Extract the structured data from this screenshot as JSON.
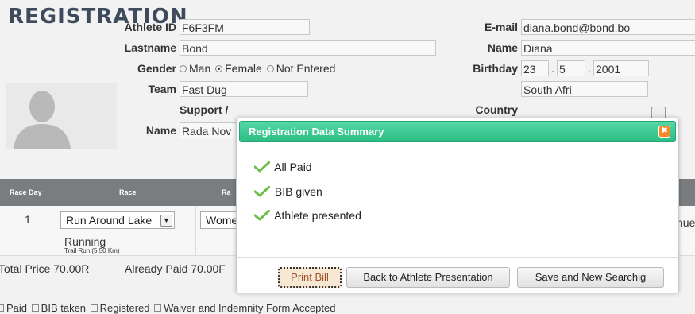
{
  "page": {
    "title": "REGISTRATION"
  },
  "form": {
    "athlete_id": {
      "label": "Athlete ID",
      "value": "F6F3FM"
    },
    "lastname": {
      "label": "Lastname",
      "value": "Bond"
    },
    "gender": {
      "label": "Gender",
      "options": [
        "Man",
        "Female",
        "Not Entered"
      ],
      "selected": "Female"
    },
    "team": {
      "label": "Team",
      "value": "Fast Dug"
    },
    "support": {
      "label": "Support /"
    },
    "name2": {
      "label": "Name",
      "value": "Rada Nov"
    },
    "email": {
      "label": "E-mail",
      "value": "diana.bond@bond.bo"
    },
    "name": {
      "label": "Name",
      "value": "Diana"
    },
    "birthday": {
      "label": "Birthday",
      "day": "23",
      "month": "5",
      "year": "2001",
      "sep": "."
    },
    "country": {
      "label": "Country",
      "value": "South Afri"
    }
  },
  "table": {
    "headers": {
      "race_day": "Race Day",
      "race": "Race",
      "race2": "Ra"
    },
    "row": {
      "day": "1",
      "race_select": "Run Around Lake",
      "race_type": "Running",
      "race_sub": "Trail Run (5.50 Km)",
      "category": "Wome",
      "right_cut": "nue"
    }
  },
  "footer": {
    "total": "Total Price 70.00R",
    "already": "Already Paid 70.00F",
    "checks": [
      "Paid",
      "BIB taken",
      "Registered",
      "Waiver and Indemnity Form Accepted"
    ]
  },
  "dialog": {
    "title": "Registration Data Summary",
    "items": [
      "All Paid",
      "BIB given",
      "Athlete presented"
    ],
    "buttons": {
      "print": "Print Bill",
      "back": "Back to Athlete Presentation",
      "save": "Save and New Searchig"
    },
    "colors": {
      "titlebar": "#2bbd84",
      "close": "#f48a2a",
      "check": "#6cc04a"
    }
  }
}
